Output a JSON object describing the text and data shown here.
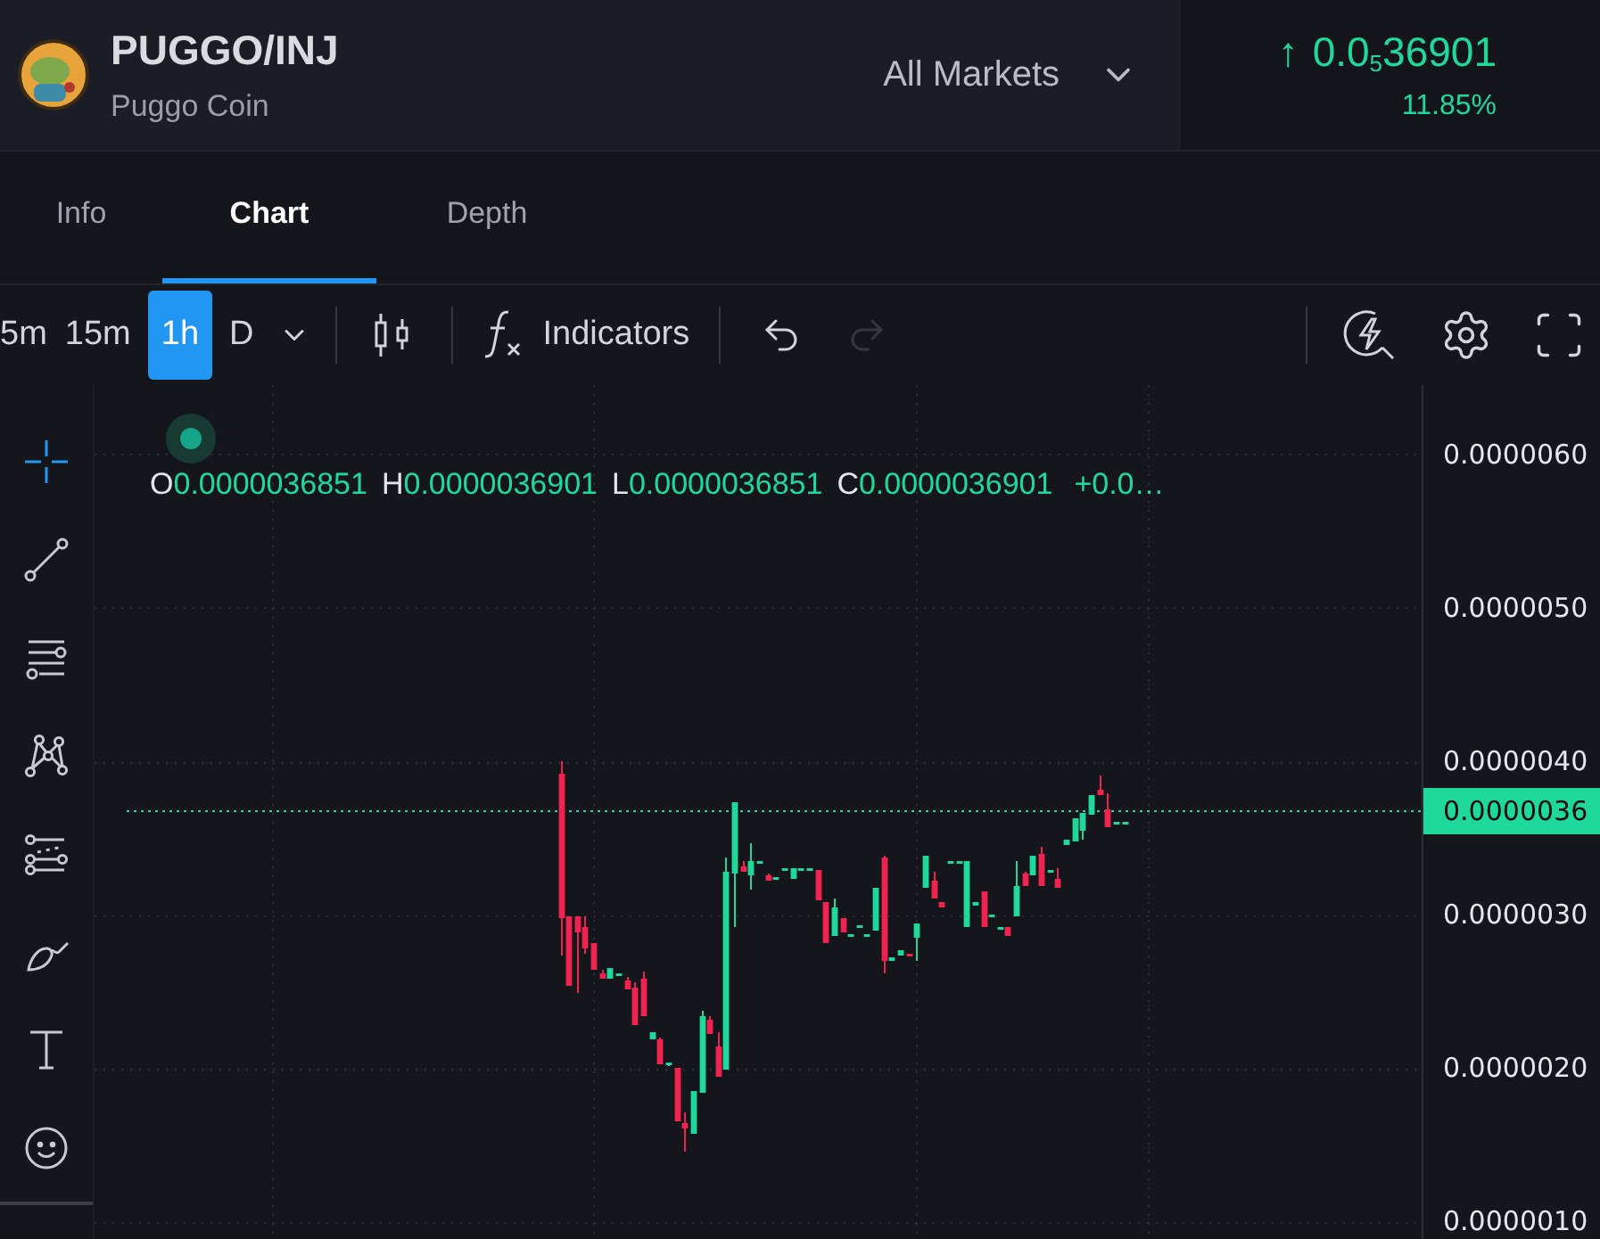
{
  "header": {
    "pair": "PUGGO/INJ",
    "name": "Puggo Coin",
    "market_selector": "All Markets",
    "arrow": "↑",
    "price": "0.0$_{5}$36901",
    "change": "11.85%"
  },
  "tabs": [
    {
      "label": "Info",
      "selected": false
    },
    {
      "label": "Chart",
      "selected": true
    },
    {
      "label": "Depth",
      "selected": false
    }
  ],
  "toolbar": {
    "intervals": [
      {
        "label": "5m",
        "selected": false
      },
      {
        "label": "15m",
        "selected": false
      },
      {
        "label": "1h",
        "selected": true
      },
      {
        "label": "D",
        "selected": false
      }
    ],
    "indicators": "Indicators",
    "undo": {
      "disabled": false
    },
    "redo": {
      "disabled": true
    }
  },
  "drawing_tools": [
    {
      "kind": "crosshair",
      "selected": true
    },
    {
      "kind": "trend-line",
      "selected": false
    },
    {
      "kind": "parallel-lines",
      "selected": false
    },
    {
      "kind": "pattern",
      "selected": false
    },
    {
      "kind": "fib-levels",
      "selected": false
    },
    {
      "kind": "brush",
      "selected": false
    },
    {
      "kind": "text",
      "selected": false
    },
    {
      "kind": "emoji",
      "selected": false
    }
  ],
  "legend": {
    "values": [
      {
        "label": "O",
        "value": "0.0000036851"
      },
      {
        "label": "H",
        "value": "0.0000036901"
      },
      {
        "label": "L",
        "value": "0.0000036851"
      },
      {
        "label": "C",
        "value": "0.0000036901"
      }
    ],
    "change": "+0.0…"
  },
  "price_axis": {
    "ticks": [
      "0.0000060",
      "0.0000050",
      "0.0000040",
      "0.0000030",
      "0.0000020",
      "0.0000010"
    ],
    "current": "0.0000036"
  }
}
